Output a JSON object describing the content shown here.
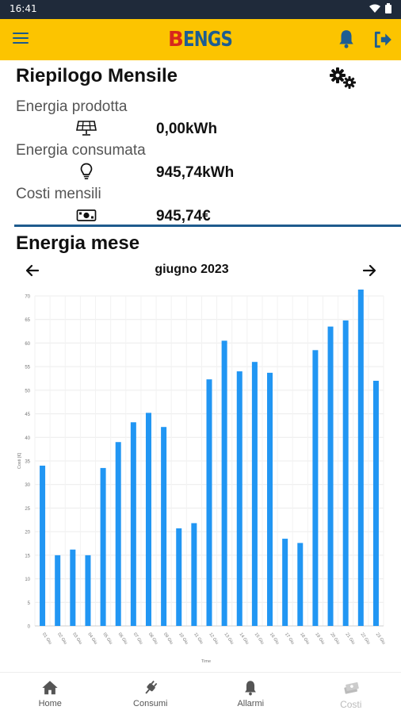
{
  "status": {
    "time": "16:41"
  },
  "app": {
    "logo_first": "B",
    "logo_rest": "ENGS"
  },
  "summary": {
    "title": "Riepilogo Mensile",
    "metrics": [
      {
        "label": "Energia prodotta",
        "value": "0,00kWh",
        "icon": "solar-panel-icon"
      },
      {
        "label": "Energia consumata",
        "value": "945,74kWh",
        "icon": "lightbulb-icon"
      },
      {
        "label": "Costi mensili",
        "value": "945,74€",
        "icon": "banknote-icon"
      }
    ]
  },
  "energy": {
    "title": "Energia mese",
    "month": "giugno 2023"
  },
  "chart_data": {
    "type": "bar",
    "color": "#2196f3",
    "xlabel": "Time",
    "ylabel": "Costi [€]",
    "ylim": [
      0,
      70
    ],
    "yticks": [
      "0",
      "5",
      "10",
      "15",
      "20",
      "25",
      "30",
      "35",
      "40",
      "45",
      "50",
      "55",
      "60",
      "65",
      "70"
    ],
    "categories": [
      "01 Giu",
      "02 Giu",
      "03 Giu",
      "04 Giu",
      "05 Giu",
      "06 Giu",
      "07 Giu",
      "08 Giu",
      "09 Giu",
      "10 Giu",
      "11 Giu",
      "12 Giu",
      "13 Giu",
      "14 Giu",
      "15 Giu",
      "16 Giu",
      "17 Giu",
      "18 Giu",
      "19 Giu",
      "20 Giu",
      "21 Giu",
      "22 Giu",
      "23 Giu"
    ],
    "values": [
      34,
      15,
      16.2,
      15,
      33.5,
      39,
      43.2,
      45.2,
      42.2,
      20.7,
      21.8,
      52.3,
      60.5,
      54,
      56,
      53.7,
      18.5,
      17.6,
      58.5,
      63.5,
      64.8,
      72.5,
      52
    ]
  },
  "nav": {
    "items": [
      {
        "label": "Home",
        "icon": "home-icon"
      },
      {
        "label": "Consumi",
        "icon": "plug-icon"
      },
      {
        "label": "Allarmi",
        "icon": "bell-icon"
      },
      {
        "label": "Costi",
        "icon": "money-icon"
      }
    ]
  }
}
